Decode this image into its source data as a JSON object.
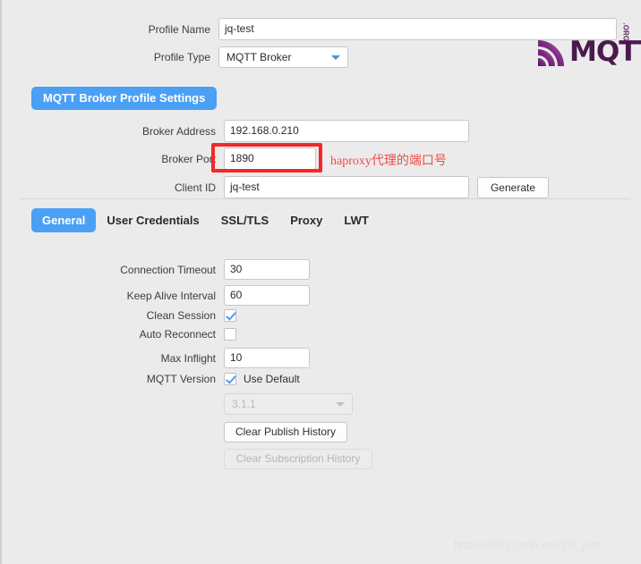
{
  "header": {
    "profile_name_label": "Profile Name",
    "profile_name_value": "jq-test",
    "profile_type_label": "Profile Type",
    "profile_type_value": "MQTT Broker"
  },
  "logo": {
    "text": "MQTT",
    "suffix": ".ORG",
    "accent": "#4a1a4e"
  },
  "broker_section": {
    "title": "MQTT Broker Profile Settings",
    "broker_address_label": "Broker Address",
    "broker_address_value": "192.168.0.210",
    "broker_port_label": "Broker Port",
    "broker_port_value": "1890",
    "client_id_label": "Client ID",
    "client_id_value": "jq-test",
    "generate_label": "Generate"
  },
  "tabs": [
    {
      "label": "General",
      "active": true
    },
    {
      "label": "User Credentials",
      "active": false
    },
    {
      "label": "SSL/TLS",
      "active": false
    },
    {
      "label": "Proxy",
      "active": false
    },
    {
      "label": "LWT",
      "active": false
    }
  ],
  "general": {
    "connection_timeout_label": "Connection Timeout",
    "connection_timeout_value": "30",
    "keep_alive_label": "Keep Alive Interval",
    "keep_alive_value": "60",
    "clean_session_label": "Clean Session",
    "clean_session_checked": true,
    "auto_reconnect_label": "Auto Reconnect",
    "auto_reconnect_checked": false,
    "max_inflight_label": "Max Inflight",
    "max_inflight_value": "10",
    "mqtt_version_label": "MQTT Version",
    "use_default_label": "Use Default",
    "use_default_checked": true,
    "mqtt_version_value": "3.1.1",
    "clear_publish_label": "Clear Publish History",
    "clear_subscription_label": "Clear Subscription History"
  },
  "annotation": {
    "note": "haproxy代理的端口号",
    "color": "#f04a4a"
  },
  "watermark": {
    "text": "https://blog.csdn.net/zsf_join"
  },
  "theme": {
    "accent_blue": "#4ba0f5",
    "background": "#ebebeb",
    "annotation_red": "#f2272a"
  }
}
